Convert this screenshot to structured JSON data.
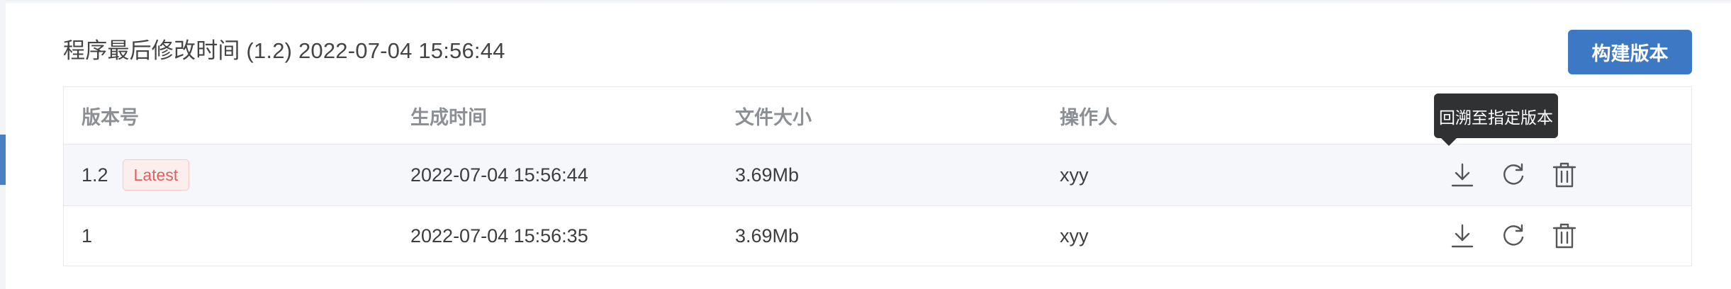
{
  "header": {
    "title": "程序最后修改时间 (1.2) 2022-07-04 15:56:44",
    "build_button_label": "构建版本"
  },
  "table": {
    "columns": [
      "版本号",
      "生成时间",
      "文件大小",
      "操作人"
    ],
    "rows": [
      {
        "version": "1.2",
        "badge": "Latest",
        "time": "2022-07-04 15:56:44",
        "size": "3.69Mb",
        "operator": "xyy",
        "actions": [
          "download-icon",
          "restore-icon",
          "trash-icon"
        ]
      },
      {
        "version": "1",
        "time": "2022-07-04 15:56:35",
        "size": "3.69Mb",
        "operator": "xyy",
        "actions": [
          "download-icon",
          "restore-icon",
          "trash-icon"
        ]
      }
    ]
  },
  "tooltip": {
    "text": "回溯至指定版本"
  },
  "colors": {
    "accent": "#3d78c4",
    "badge_text": "#e0605f",
    "badge_bg": "#fdeeee",
    "tooltip_bg": "#303133",
    "row_highlight": "#f5f7fa"
  }
}
